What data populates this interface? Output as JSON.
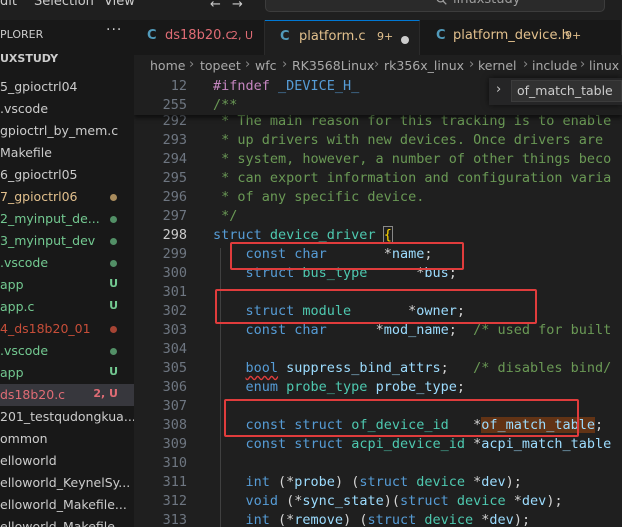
{
  "menubar": {
    "items": [
      "dit",
      "Selection",
      "View"
    ],
    "search_text": "linuxstudy"
  },
  "sidebar": {
    "title": "PLORER",
    "root": "UXSTUDY",
    "items": [
      {
        "label": "5_gpioctrl04",
        "color": "#cccccc"
      },
      {
        "label": ".vscode",
        "color": "#cccccc"
      },
      {
        "label": "gpioctrl_by_mem.c",
        "color": "#cccccc"
      },
      {
        "label": "Makefile",
        "color": "#cccccc"
      },
      {
        "label": "6_gpioctrl05",
        "color": "#cccccc"
      },
      {
        "label": "7_gpioctrl06",
        "color": "#e2c08d",
        "dot": "#a88b5c"
      },
      {
        "label": "2_myinput_de...",
        "color": "#73c991",
        "dot": "#528f66"
      },
      {
        "label": "3_myinput_dev",
        "color": "#73c991",
        "dot": "#528f66"
      },
      {
        "label": ".vscode",
        "color": "#73c991",
        "dot": "#528f66"
      },
      {
        "label": "app",
        "color": "#73c991",
        "badge": "U"
      },
      {
        "label": "app.c",
        "color": "#73c991",
        "badge": "U"
      },
      {
        "label": "4_ds18b20_01",
        "color": "#c74e39",
        "dot": "#a64434"
      },
      {
        "label": ".vscode",
        "color": "#73c991",
        "dot": "#528f66"
      },
      {
        "label": "app",
        "color": "#73c991",
        "badge": "U"
      },
      {
        "label": "ds18b20.c",
        "color": "#e06c75",
        "badge": "2, U",
        "selected": true
      },
      {
        "label": "201_testqudongkua...",
        "color": "#cccccc"
      },
      {
        "label": "ommon",
        "color": "#cccccc"
      },
      {
        "label": "elloworld",
        "color": "#cccccc"
      },
      {
        "label": "elloworld_KeynelSy...",
        "color": "#cccccc"
      },
      {
        "label": "elloworld_Makefile...",
        "color": "#cccccc"
      },
      {
        "label": "elloworld_Makefile...",
        "color": "#cccccc"
      }
    ]
  },
  "tabs": [
    {
      "icon": "C",
      "name": "ds18b20.c",
      "status": "2, U",
      "name_color": "#e06c75",
      "status_color": "#e06c75",
      "active": false
    },
    {
      "icon": "C",
      "name": "platform.c",
      "status": "9+",
      "name_color": "#e2c08d",
      "status_color": "#e2c08d",
      "active": true,
      "dirty": true
    },
    {
      "icon": "C",
      "name": "platform_device.h",
      "status": "9+",
      "name_color": "#e2c08d",
      "status_color": "#e2c08d",
      "active": false
    }
  ],
  "breadcrumb": [
    "home",
    "topeet",
    "wfc",
    "RK3568Linux",
    "rk356x_linux",
    "kernel",
    "include",
    "linux"
  ],
  "find_widget": {
    "value": "of_match_table"
  },
  "editor": {
    "sticky": [
      {
        "ln": "12",
        "tokens": [
          [
            "#ifndef ",
            "k-pre"
          ],
          [
            "_DEVICE_H_",
            "k-macro"
          ]
        ]
      },
      {
        "ln": "255",
        "tokens": [
          [
            "/**",
            "k-com"
          ]
        ]
      }
    ],
    "lines": [
      {
        "ln": "292",
        "tokens": [
          [
            " * The main reason for this tracking is to enable",
            "k-com"
          ]
        ]
      },
      {
        "ln": "293",
        "tokens": [
          [
            " * up drivers with new devices. Once drivers are",
            "k-com"
          ]
        ]
      },
      {
        "ln": "294",
        "tokens": [
          [
            " * system, however, a number of other things beco",
            "k-com"
          ]
        ]
      },
      {
        "ln": "295",
        "tokens": [
          [
            " * can export information and configuration varia",
            "k-com"
          ]
        ]
      },
      {
        "ln": "296",
        "tokens": [
          [
            " * of any specific device.",
            "k-com"
          ]
        ]
      },
      {
        "ln": "297",
        "tokens": [
          [
            " */",
            "k-com"
          ]
        ]
      },
      {
        "ln": "298",
        "cur": true,
        "tokens": [
          [
            "struct ",
            "k-kw"
          ],
          [
            "device_driver",
            "k-type"
          ],
          [
            " ",
            "k-p"
          ],
          [
            "{",
            "k-brace"
          ]
        ]
      },
      {
        "ln": "299",
        "tokens": [
          [
            "    const ",
            "k-kw"
          ],
          [
            "char",
            "k-kw"
          ],
          [
            "       *",
            "k-p"
          ],
          [
            "name",
            "k-id"
          ],
          [
            ";",
            "k-p"
          ]
        ]
      },
      {
        "ln": "300",
        "tokens": [
          [
            "    struct ",
            "k-kw"
          ],
          [
            "bus_type",
            "k-type"
          ],
          [
            "      *",
            "k-p"
          ],
          [
            "bus",
            "k-id"
          ],
          [
            ";",
            "k-p"
          ]
        ]
      },
      {
        "ln": "301",
        "tokens": []
      },
      {
        "ln": "302",
        "tokens": [
          [
            "    struct ",
            "k-kw"
          ],
          [
            "module",
            "k-type"
          ],
          [
            "       *",
            "k-p"
          ],
          [
            "owner",
            "k-id"
          ],
          [
            ";",
            "k-p"
          ]
        ]
      },
      {
        "ln": "303",
        "tokens": [
          [
            "    const ",
            "k-kw"
          ],
          [
            "char",
            "k-kw"
          ],
          [
            "      *",
            "k-p"
          ],
          [
            "mod_name",
            "k-id"
          ],
          [
            ";  ",
            "k-p"
          ],
          [
            "/* used for built",
            "k-com"
          ]
        ]
      },
      {
        "ln": "304",
        "tokens": []
      },
      {
        "ln": "305",
        "tokens": [
          [
            "    ",
            "k-p"
          ],
          [
            "bool",
            "k-kw k-warn"
          ],
          [
            " ",
            "k-p"
          ],
          [
            "suppress_bind_attrs",
            "k-id"
          ],
          [
            ";   ",
            "k-p"
          ],
          [
            "/* disables bind/",
            "k-com"
          ]
        ]
      },
      {
        "ln": "306",
        "tokens": [
          [
            "    enum ",
            "k-kw"
          ],
          [
            "probe_type",
            "k-type"
          ],
          [
            " ",
            "k-p"
          ],
          [
            "probe_type",
            "k-id"
          ],
          [
            ";",
            "k-p"
          ]
        ]
      },
      {
        "ln": "307",
        "tokens": []
      },
      {
        "ln": "308",
        "tokens": [
          [
            "    const ",
            "k-kw"
          ],
          [
            "struct ",
            "k-kw"
          ],
          [
            "of_device_id",
            "k-type"
          ],
          [
            "   *",
            "k-p"
          ],
          [
            "of_match_table",
            "k-id k-match"
          ],
          [
            ";",
            "k-p"
          ]
        ]
      },
      {
        "ln": "309",
        "tokens": [
          [
            "    const ",
            "k-kw"
          ],
          [
            "struct ",
            "k-kw"
          ],
          [
            "acpi_device_id",
            "k-type"
          ],
          [
            " *",
            "k-p"
          ],
          [
            "acpi_match_table",
            "k-id"
          ]
        ]
      },
      {
        "ln": "310",
        "tokens": []
      },
      {
        "ln": "311",
        "tokens": [
          [
            "    int ",
            "k-kw"
          ],
          [
            "(*",
            "k-p"
          ],
          [
            "probe",
            "k-id"
          ],
          [
            ") (",
            "k-p"
          ],
          [
            "struct ",
            "k-kw"
          ],
          [
            "device ",
            "k-type"
          ],
          [
            "*",
            "k-p"
          ],
          [
            "dev",
            "k-id"
          ],
          [
            ");",
            "k-p"
          ]
        ]
      },
      {
        "ln": "312",
        "tokens": [
          [
            "    void ",
            "k-kw"
          ],
          [
            "(*",
            "k-p"
          ],
          [
            "sync_state",
            "k-id"
          ],
          [
            ")(",
            "k-p"
          ],
          [
            "struct ",
            "k-kw"
          ],
          [
            "device ",
            "k-type"
          ],
          [
            "*",
            "k-p"
          ],
          [
            "dev",
            "k-id"
          ],
          [
            ");",
            "k-p"
          ]
        ]
      },
      {
        "ln": "313",
        "tokens": [
          [
            "    int ",
            "k-kw"
          ],
          [
            "(*",
            "k-p"
          ],
          [
            "remove",
            "k-id"
          ],
          [
            ") (",
            "k-p"
          ],
          [
            "struct ",
            "k-kw"
          ],
          [
            "device ",
            "k-type"
          ],
          [
            "*",
            "k-p"
          ],
          [
            "dev",
            "k-id"
          ],
          [
            ");",
            "k-p"
          ]
        ]
      }
    ]
  }
}
